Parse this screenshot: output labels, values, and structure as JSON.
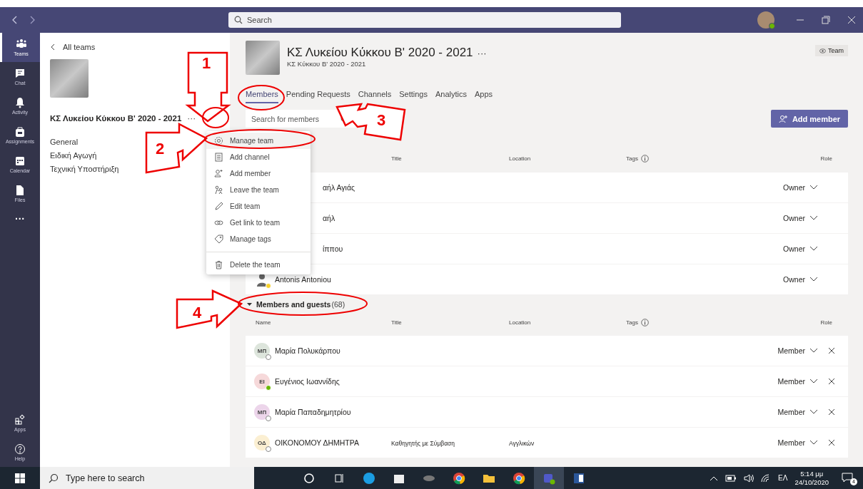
{
  "top_bar": {
    "search_placeholder": "Search"
  },
  "rail": {
    "items": [
      {
        "label": "Teams",
        "selected": true
      },
      {
        "label": "Chat",
        "selected": false
      },
      {
        "label": "Activity",
        "selected": false
      },
      {
        "label": "Assignments",
        "selected": false
      },
      {
        "label": "Calendar",
        "selected": false
      },
      {
        "label": "Files",
        "selected": false
      }
    ],
    "more": "···",
    "bottom": [
      {
        "label": "Apps"
      },
      {
        "label": "Help"
      }
    ]
  },
  "side_panel": {
    "back": "All teams",
    "team_name": "ΚΣ Λυκείου Κύκκου Β' 2020 - 2021",
    "more": "···",
    "channels": [
      "General",
      "Ειδική Αγωγή",
      "Τεχνική Υποστήριξη"
    ]
  },
  "team_menu": [
    {
      "label": "Manage team",
      "selected": true,
      "separated": false
    },
    {
      "label": "Add channel",
      "selected": false,
      "separated": false
    },
    {
      "label": "Add member",
      "selected": false,
      "separated": false
    },
    {
      "label": "Leave the team",
      "selected": false,
      "separated": false
    },
    {
      "label": "Edit team",
      "selected": false,
      "separated": false
    },
    {
      "label": "Get link to team",
      "selected": false,
      "separated": false
    },
    {
      "label": "Manage tags",
      "selected": false,
      "separated": false
    },
    {
      "label": "Delete the team",
      "selected": false,
      "separated": true
    }
  ],
  "header": {
    "title": "ΚΣ Λυκείου Κύκκου Β' 2020 - 2021",
    "more": "···",
    "subtitle": "ΚΣ Κύκκου Β' 2020 - 2021",
    "badge": "Team"
  },
  "tabs": [
    {
      "label": "Members",
      "selected": true
    },
    {
      "label": "Pending Requests",
      "selected": false
    },
    {
      "label": "Channels",
      "selected": false
    },
    {
      "label": "Settings",
      "selected": false
    },
    {
      "label": "Analytics",
      "selected": false
    },
    {
      "label": "Apps",
      "selected": false
    }
  ],
  "search": {
    "placeholder": "Search for members"
  },
  "add_member": "Add member",
  "owners": {
    "headers": {
      "title": "Title",
      "location": "Location",
      "tags": "Tags",
      "role": "Role"
    },
    "rows": [
      {
        "name": "αήλ Αγιάς",
        "covered": true,
        "role": "Owner"
      },
      {
        "name": "αήλ",
        "covered": true,
        "role": "Owner"
      },
      {
        "name": "ίππου",
        "covered": true,
        "role": "Owner"
      },
      {
        "name": "Antonis Antoniou",
        "covered": false,
        "away": true,
        "role": "Owner"
      }
    ]
  },
  "members": {
    "heading": "Members and guests",
    "count": "(68)",
    "expanded": true,
    "headers": {
      "name": "Name",
      "title": "Title",
      "location": "Location",
      "tags": "Tags",
      "role": "Role"
    },
    "rows": [
      {
        "initials": "ΜΠ",
        "color": "#dde5dc",
        "name": "Μαρία Πολυκάρπου",
        "online": false,
        "role": "Member"
      },
      {
        "initials": "ΕΙ",
        "color": "#f6d9da",
        "name": "Ευγένιος Ιωαννίδης",
        "online": true,
        "role": "Member"
      },
      {
        "initials": "ΜΠ",
        "color": "#ecd5ea",
        "name": "Μαρία Παπαδημητρίου",
        "online": false,
        "role": "Member"
      },
      {
        "initials": "ΟΔ",
        "color": "#fbefd2",
        "name": "ΟΙΚΟΝΟΜΟΥ ΔΗΜΗΤΡΑ",
        "title": "Καθηγητής με Σύμβαση",
        "location": "Αγγλικών",
        "online": false,
        "role": "Member"
      }
    ]
  },
  "callouts": [
    "1",
    "2",
    "3",
    "4"
  ],
  "taskbar": {
    "search_placeholder": "Type here to search",
    "language": "ΕΛ",
    "time": "5:14 μμ",
    "date": "24/10/2020",
    "notifications": "4"
  }
}
